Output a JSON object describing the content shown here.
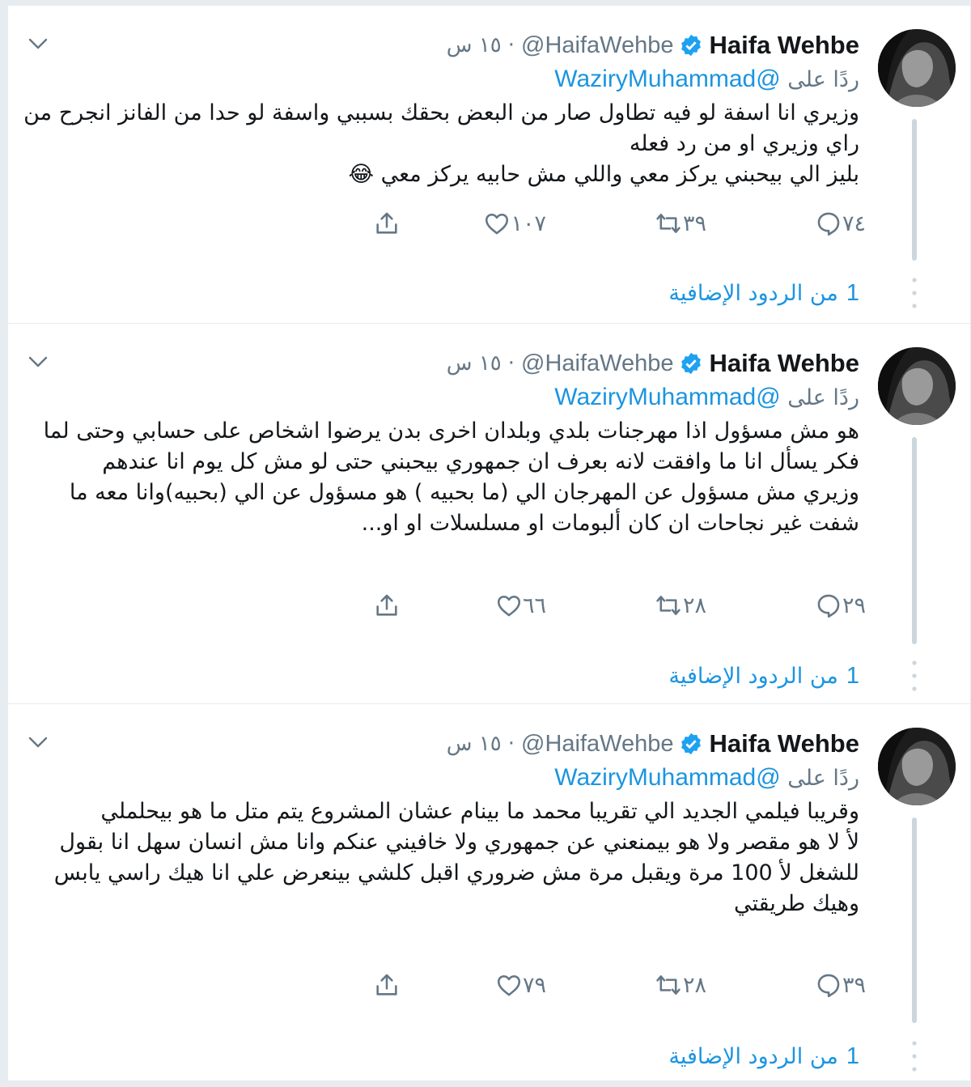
{
  "icons": {
    "verified": "verified-badge-icon",
    "caret": "chevron-down-icon",
    "reply": "reply-icon",
    "retweet": "retweet-icon",
    "like": "heart-icon",
    "share": "share-icon",
    "more": "vertical-dots-icon"
  },
  "colors": {
    "link": "#1b95e0",
    "secondary_text": "#657786",
    "thread_line": "#ccd6dd"
  },
  "tweets": [
    {
      "name": "Haifa Wehbe",
      "handle": "@HaifaWehbe",
      "separator": "·",
      "time": "١٥ س",
      "reply_prefix": "ردًا على",
      "reply_mention": "@WaziryMuhammad",
      "text": "وزيري انا اسفة لو فيه تطاول صار من البعض بحقك بسببي واسفة لو حدا من الفانز انجرح من راي وزيري او من رد فعله\nبليز الي بيحبني يركز معي واللي مش حابيه يركز معي 😂",
      "replies": "٧٤",
      "retweets": "٣٩",
      "likes": "١٠٧",
      "more_count": "1",
      "more_label": "من الردود الإضافية"
    },
    {
      "name": "Haifa Wehbe",
      "handle": "@HaifaWehbe",
      "separator": "·",
      "time": "١٥ س",
      "reply_prefix": "ردًا على",
      "reply_mention": "@WaziryMuhammad",
      "text": "هو مش مسؤول اذا مهرجنات بلدي وبلدان اخرى بدن يرضوا اشخاص على حسابي وحتى لما فكر يسأل انا ما وافقت لانه بعرف ان جمهوري بيحبني حتى لو مش كل يوم انا عندهم\nوزيري مش مسؤول عن المهرجان الي (ما بحبيه ) هو مسؤول عن الي (بحبيه)وانا معه ما شفت غير نجاحات ان كان ألبومات او مسلسلات او او...",
      "replies": "٢٩",
      "retweets": "٢٨",
      "likes": "٦٦",
      "more_count": "1",
      "more_label": "من الردود الإضافية"
    },
    {
      "name": "Haifa Wehbe",
      "handle": "@HaifaWehbe",
      "separator": "·",
      "time": "١٥ س",
      "reply_prefix": "ردًا على",
      "reply_mention": "@WaziryMuhammad",
      "text": "وقريبا فيلمي الجديد الي تقريبا  محمد ما بينام عشان المشروع يتم متل ما هو بيحلملي\nلأ لا هو مقصر ولا هو بيمنعني عن جمهوري ولا خافيني عنكم وانا مش انسان سهل انا بقول للشغل لأ 100 مرة ويقبل مرة مش ضروري اقبل كلشي بينعرض علي انا هيك راسي يابس وهيك طريقتي",
      "replies": "٣٩",
      "retweets": "٢٨",
      "likes": "٧٩",
      "more_count": "1",
      "more_label": "من الردود الإضافية"
    }
  ]
}
